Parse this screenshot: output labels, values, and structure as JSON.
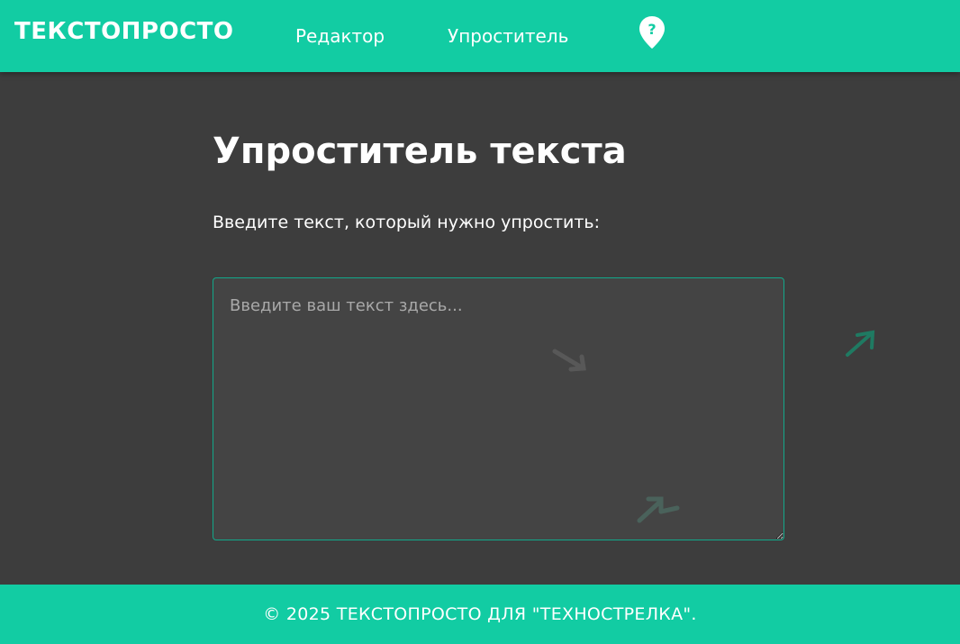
{
  "header": {
    "brand": "ТЕКСТОПРОСТО",
    "nav": [
      {
        "label": "Редактор"
      },
      {
        "label": "Упроститель"
      }
    ],
    "help_icon": "map-pin-question-icon"
  },
  "main": {
    "title": "Упроститель текста",
    "prompt": "Введите текст, который нужно упростить:",
    "textarea": {
      "value": "",
      "placeholder": "Введите ваш текст здесь..."
    }
  },
  "footer": {
    "text": "© 2025 ТЕКСТОПРОСТО ДЛЯ \"ТЕХНОСТРЕЛКА\"."
  },
  "colors": {
    "accent": "#12cca3",
    "background": "#3d3d3d",
    "textarea_bg": "#444444",
    "textarea_border": "#12a88a"
  }
}
